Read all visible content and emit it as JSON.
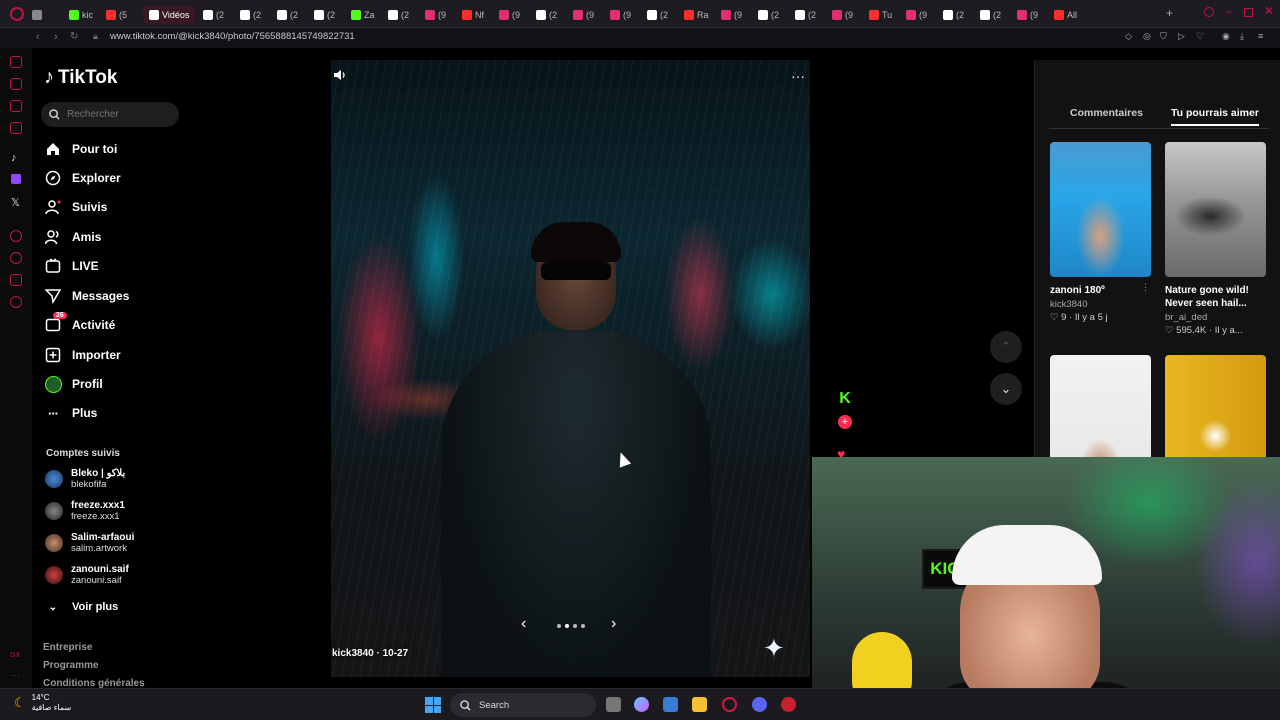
{
  "browser": {
    "url": "www.tiktok.com/@kick3840/photo/7565888145749822731",
    "tabs": [
      {
        "label": "",
        "color": "#888888"
      },
      {
        "label": "kic",
        "color": "#53fc18"
      },
      {
        "label": "(5",
        "color": "#ff2d2d"
      },
      {
        "label": "Vidéos",
        "color": "#ffffff"
      },
      {
        "label": "(2",
        "color": "#ffffff"
      },
      {
        "label": "(2",
        "color": "#ffffff"
      },
      {
        "label": "(2",
        "color": "#ffffff"
      },
      {
        "label": "(2",
        "color": "#ffffff"
      },
      {
        "label": "Za",
        "color": "#53fc18"
      },
      {
        "label": "(2",
        "color": "#ffffff"
      },
      {
        "label": "(9",
        "color": "#e1306c"
      },
      {
        "label": "Nf",
        "color": "#ff2d2d"
      },
      {
        "label": "(9",
        "color": "#e1306c"
      },
      {
        "label": "(2",
        "color": "#ffffff"
      },
      {
        "label": "(9",
        "color": "#e1306c"
      },
      {
        "label": "(9",
        "color": "#e1306c"
      },
      {
        "label": "(2",
        "color": "#ffffff"
      },
      {
        "label": "Ra",
        "color": "#ff2d2d"
      },
      {
        "label": "(9",
        "color": "#e1306c"
      },
      {
        "label": "(2",
        "color": "#ffffff"
      },
      {
        "label": "(2",
        "color": "#ffffff"
      },
      {
        "label": "(9",
        "color": "#e1306c"
      },
      {
        "label": "Tu",
        "color": "#ff2d2d"
      },
      {
        "label": "(9",
        "color": "#e1306c"
      },
      {
        "label": "(2",
        "color": "#ffffff"
      },
      {
        "label": "(2",
        "color": "#ffffff"
      },
      {
        "label": "(9",
        "color": "#e1306c"
      },
      {
        "label": "All",
        "color": "#ff2d2d"
      }
    ],
    "active_tab_index": 3
  },
  "sidebar": {
    "logo": "TikTok",
    "search_placeholder": "Rechercher",
    "nav": [
      {
        "label": "Pour toi",
        "icon": "home-icon"
      },
      {
        "label": "Explorer",
        "icon": "compass-icon"
      },
      {
        "label": "Suivis",
        "icon": "following-icon"
      },
      {
        "label": "Amis",
        "icon": "friends-icon"
      },
      {
        "label": "LIVE",
        "icon": "live-icon"
      },
      {
        "label": "Messages",
        "icon": "messages-icon"
      },
      {
        "label": "Activité",
        "icon": "activity-icon",
        "badge": "26"
      },
      {
        "label": "Importer",
        "icon": "upload-icon"
      },
      {
        "label": "Profil",
        "icon": "profile-avatar"
      },
      {
        "label": "Plus",
        "icon": "more-icon"
      }
    ],
    "following_title": "Comptes suivis",
    "following": [
      {
        "name": "Bleko | بلاكو",
        "handle": "blekofifa"
      },
      {
        "name": "freeze.xxx1",
        "handle": "freeze.xxx1"
      },
      {
        "name": "Salim-arfaoui",
        "handle": "salim.artwork"
      },
      {
        "name": "zanouni.saif",
        "handle": "zanouni.saif"
      }
    ],
    "see_more": "Voir plus",
    "footer": [
      "Entreprise",
      "Programme",
      "Conditions générales"
    ]
  },
  "viewer": {
    "caption": "kick3840 · 10-27",
    "slides_total": 4,
    "slide_current": 2
  },
  "actions": {
    "author_initial": "K"
  },
  "right_panel": {
    "tabs": [
      "Commentaires",
      "Tu pourrais aimer"
    ],
    "active_tab": 1,
    "cards": [
      {
        "title": "zanoni 180º",
        "author": "kick3840",
        "stats": "9 · Il y a 5 j"
      },
      {
        "title": "Nature gone wild! Never seen hail...",
        "author": "br_ai_ded",
        "stats": "595.4K · Il y a..."
      },
      {
        "title": "",
        "author": "",
        "stats": ""
      },
      {
        "title": "",
        "author": "",
        "stats": ""
      }
    ]
  },
  "webcam": {
    "sign_text": "KICK"
  },
  "taskbar": {
    "temperature": "14°C",
    "weather_text": "سماء صافية",
    "search_label": "Search"
  }
}
